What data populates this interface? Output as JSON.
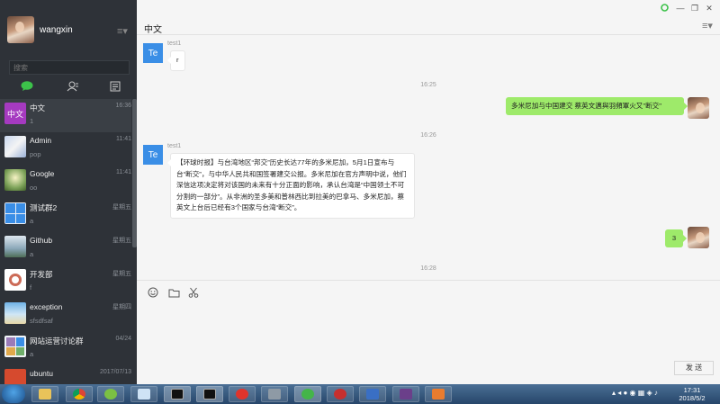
{
  "profile": {
    "name": "wangxin",
    "menu_icon": "hamburger-icon"
  },
  "search": {
    "placeholder": "搜索"
  },
  "nav": {
    "icons": [
      "chat-bubble-icon",
      "contacts-icon",
      "favorites-icon"
    ],
    "active_color": "#3cc24a"
  },
  "chats": [
    {
      "name": "中文",
      "preview": "1",
      "time": "16:36",
      "avatar_text": "中文",
      "avatar_color": "#a53ac0",
      "active": true
    },
    {
      "name": "Admin",
      "preview": "pop",
      "time": "11:41"
    },
    {
      "name": "Google",
      "preview": "oo",
      "time": "11:41"
    },
    {
      "name": "测试群2",
      "preview": "a",
      "time": "星期五"
    },
    {
      "name": "Github",
      "preview": "a",
      "time": "星期五"
    },
    {
      "name": "开发部",
      "preview": "f",
      "time": "星期五"
    },
    {
      "name": "exception",
      "preview": "sfsdfsaf",
      "time": "星期四"
    },
    {
      "name": "网站运营讨论群",
      "preview": "a",
      "time": "04/24"
    },
    {
      "name": "ubuntu",
      "preview": "",
      "time": "2017/07/13"
    }
  ],
  "conversation": {
    "title": "中文",
    "messages": [
      {
        "kind": "in",
        "sender": "test1",
        "avatar_text": "Te",
        "text": "r"
      },
      {
        "kind": "time",
        "text": "16:25"
      },
      {
        "kind": "out",
        "text": "多米尼加与中国建交 蔡英文邁與羽頻軍火又\"断交\""
      },
      {
        "kind": "time",
        "text": "16:26"
      },
      {
        "kind": "in",
        "sender": "test1",
        "avatar_text": "Te",
        "text": "【环球时报】与台湾地区“邦交”历史长达77年的多米尼加，5月1日宣布与台“断交”，与中华人民共和国签署建交公报。多米尼加在官方声明中说，他们深信这项决定将对该国的未来有十分正面的影响，承认台湾是“中国领土不可分割的一部分”。从非洲的圣多美和普林西比到拉美的巴拿马、多米尼加，蔡英文上台后已经有3个国家与台湾“断交”。"
      },
      {
        "kind": "out",
        "text": "3"
      },
      {
        "kind": "time",
        "text": "16:28"
      }
    ]
  },
  "input_toolbar": {
    "icons": [
      "emoji-icon",
      "folder-icon",
      "scissors-icon"
    ]
  },
  "send_button": {
    "label": "发 送"
  },
  "window_controls": {
    "icons": [
      "status-circle-icon",
      "minimize-icon",
      "restore-icon",
      "close-icon"
    ]
  },
  "taskbar": {
    "apps": [
      "explorer-icon",
      "chrome-icon",
      "app-green-icon",
      "notepad-icon",
      "terminal-icon",
      "terminal-icon",
      "netease-icon",
      "database-icon",
      "wechat-icon",
      "netease-music-icon",
      "trident-icon",
      "game-icon",
      "java-icon"
    ],
    "clock_time": "17:31",
    "clock_date": "2018/5/2"
  },
  "colors": {
    "sidebar": "#2e3238",
    "bubble_out": "#9eea6a",
    "avatar_te": "#3a8ee6"
  }
}
